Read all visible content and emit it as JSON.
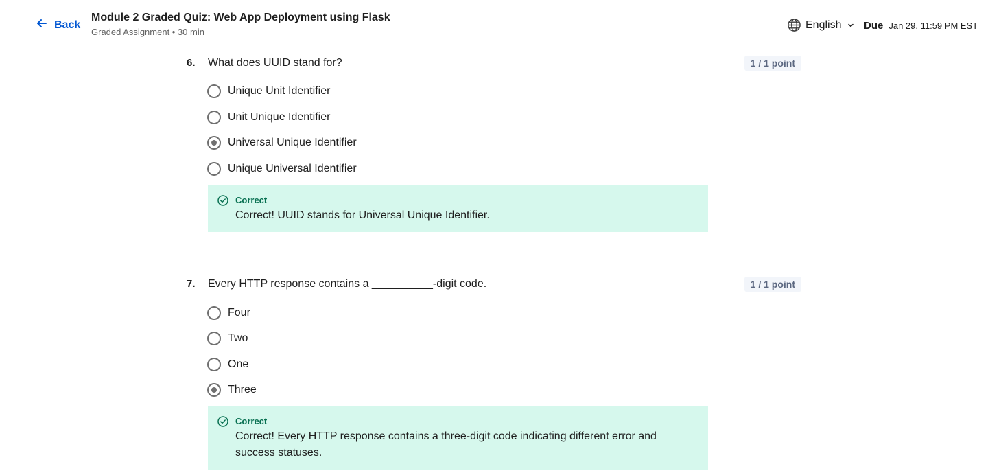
{
  "header": {
    "back_label": "Back",
    "title": "Module 2 Graded Quiz: Web App Deployment using Flask",
    "subtitle": "Graded Assignment • 30 min",
    "language": "English",
    "due_label": "Due",
    "due_value": "Jan 29, 11:59 PM EST"
  },
  "colors": {
    "accent": "#0056d2",
    "correct_bg": "#d6f8ed",
    "correct_text": "#087051",
    "points_bg": "#f2f5fa"
  },
  "questions": [
    {
      "number": "6.",
      "text": "What does UUID stand for?",
      "points": "1 / 1 point",
      "options": [
        "Unique Unit Identifier",
        "Unit Unique Identifier",
        "Universal Unique Identifier",
        "Unique Universal Identifier"
      ],
      "selected": "Universal Unique Identifier",
      "feedback": {
        "status": "Correct",
        "message": "Correct! UUID stands for Universal Unique Identifier."
      }
    },
    {
      "number": "7.",
      "text": "Every HTTP response contains a __________-digit code.",
      "points": "1 / 1 point",
      "options": [
        "Four",
        "Two",
        "One",
        "Three"
      ],
      "selected": "Three",
      "feedback": {
        "status": "Correct",
        "message": "Correct! Every HTTP response contains a three-digit code indicating different error and success statuses."
      }
    }
  ]
}
